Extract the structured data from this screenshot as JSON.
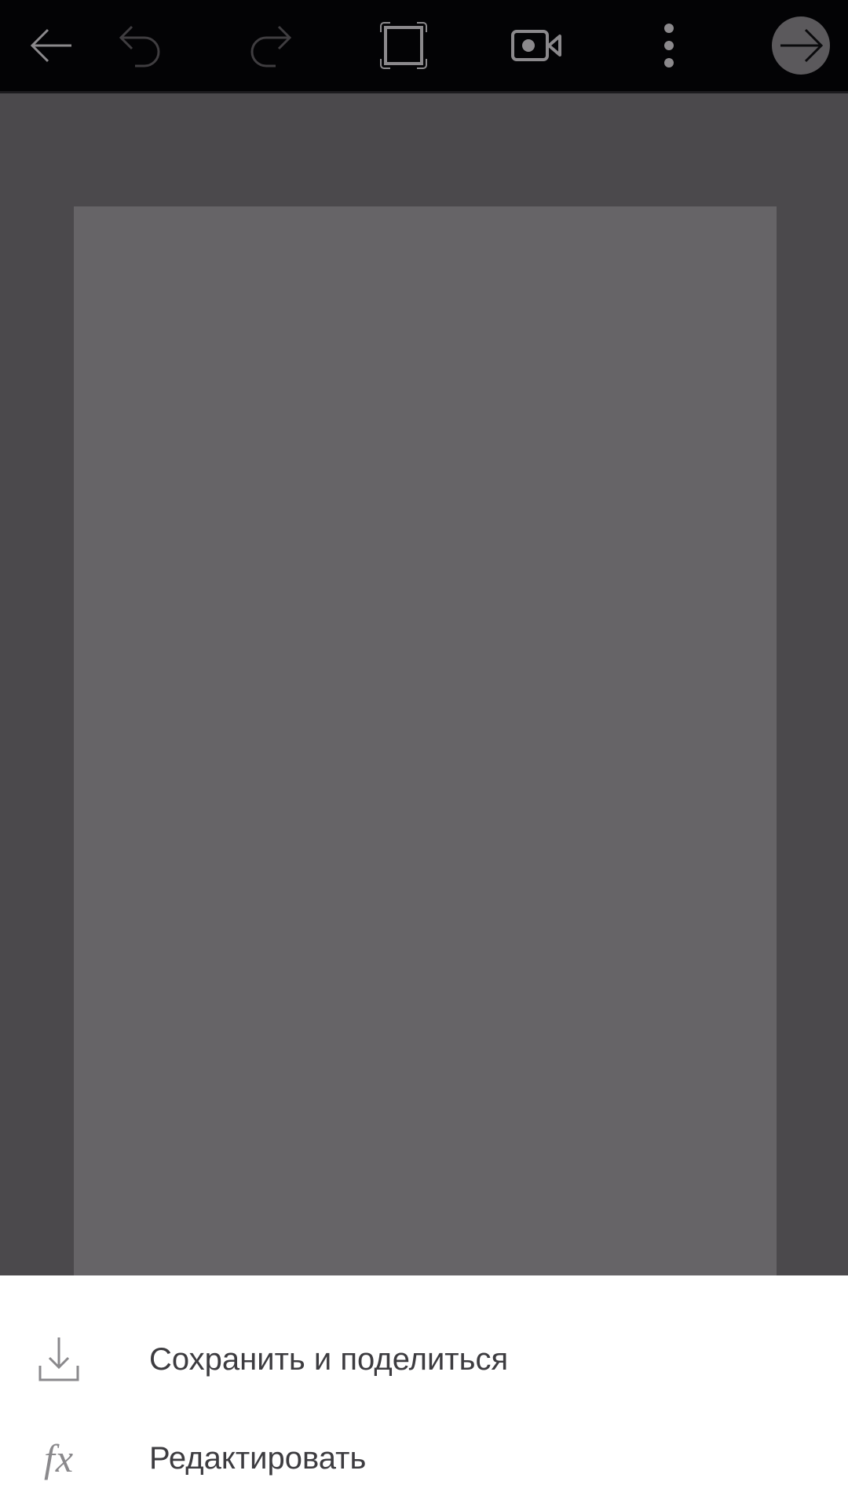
{
  "toolbar": {
    "buttons": [
      {
        "name": "back-button",
        "icon": "arrow-left-icon",
        "enabled": true
      },
      {
        "name": "undo-button",
        "icon": "undo-icon",
        "enabled": false
      },
      {
        "name": "redo-button",
        "icon": "redo-icon",
        "enabled": false
      },
      {
        "name": "fullscreen-button",
        "icon": "fullscreen-frame-icon",
        "enabled": true
      },
      {
        "name": "record-button",
        "icon": "video-camera-icon",
        "enabled": true
      },
      {
        "name": "more-button",
        "icon": "more-vertical-icon",
        "enabled": true
      },
      {
        "name": "next-button",
        "icon": "arrow-right-circle-icon",
        "enabled": true
      }
    ]
  },
  "canvas": {
    "background_color": "#4b494c",
    "page_color": "#666467"
  },
  "bottom_sheet": {
    "items": [
      {
        "icon": "download-icon",
        "label": "Сохранить и поделиться"
      },
      {
        "icon": "fx-icon",
        "icon_text": "fx",
        "label": "Редактировать"
      }
    ]
  },
  "colors": {
    "toolbar_bg": "#030305",
    "icon_enabled": "#8b898c",
    "icon_disabled": "#3f3d40",
    "sheet_bg": "#ffffff",
    "label_text": "#3d3c40"
  }
}
